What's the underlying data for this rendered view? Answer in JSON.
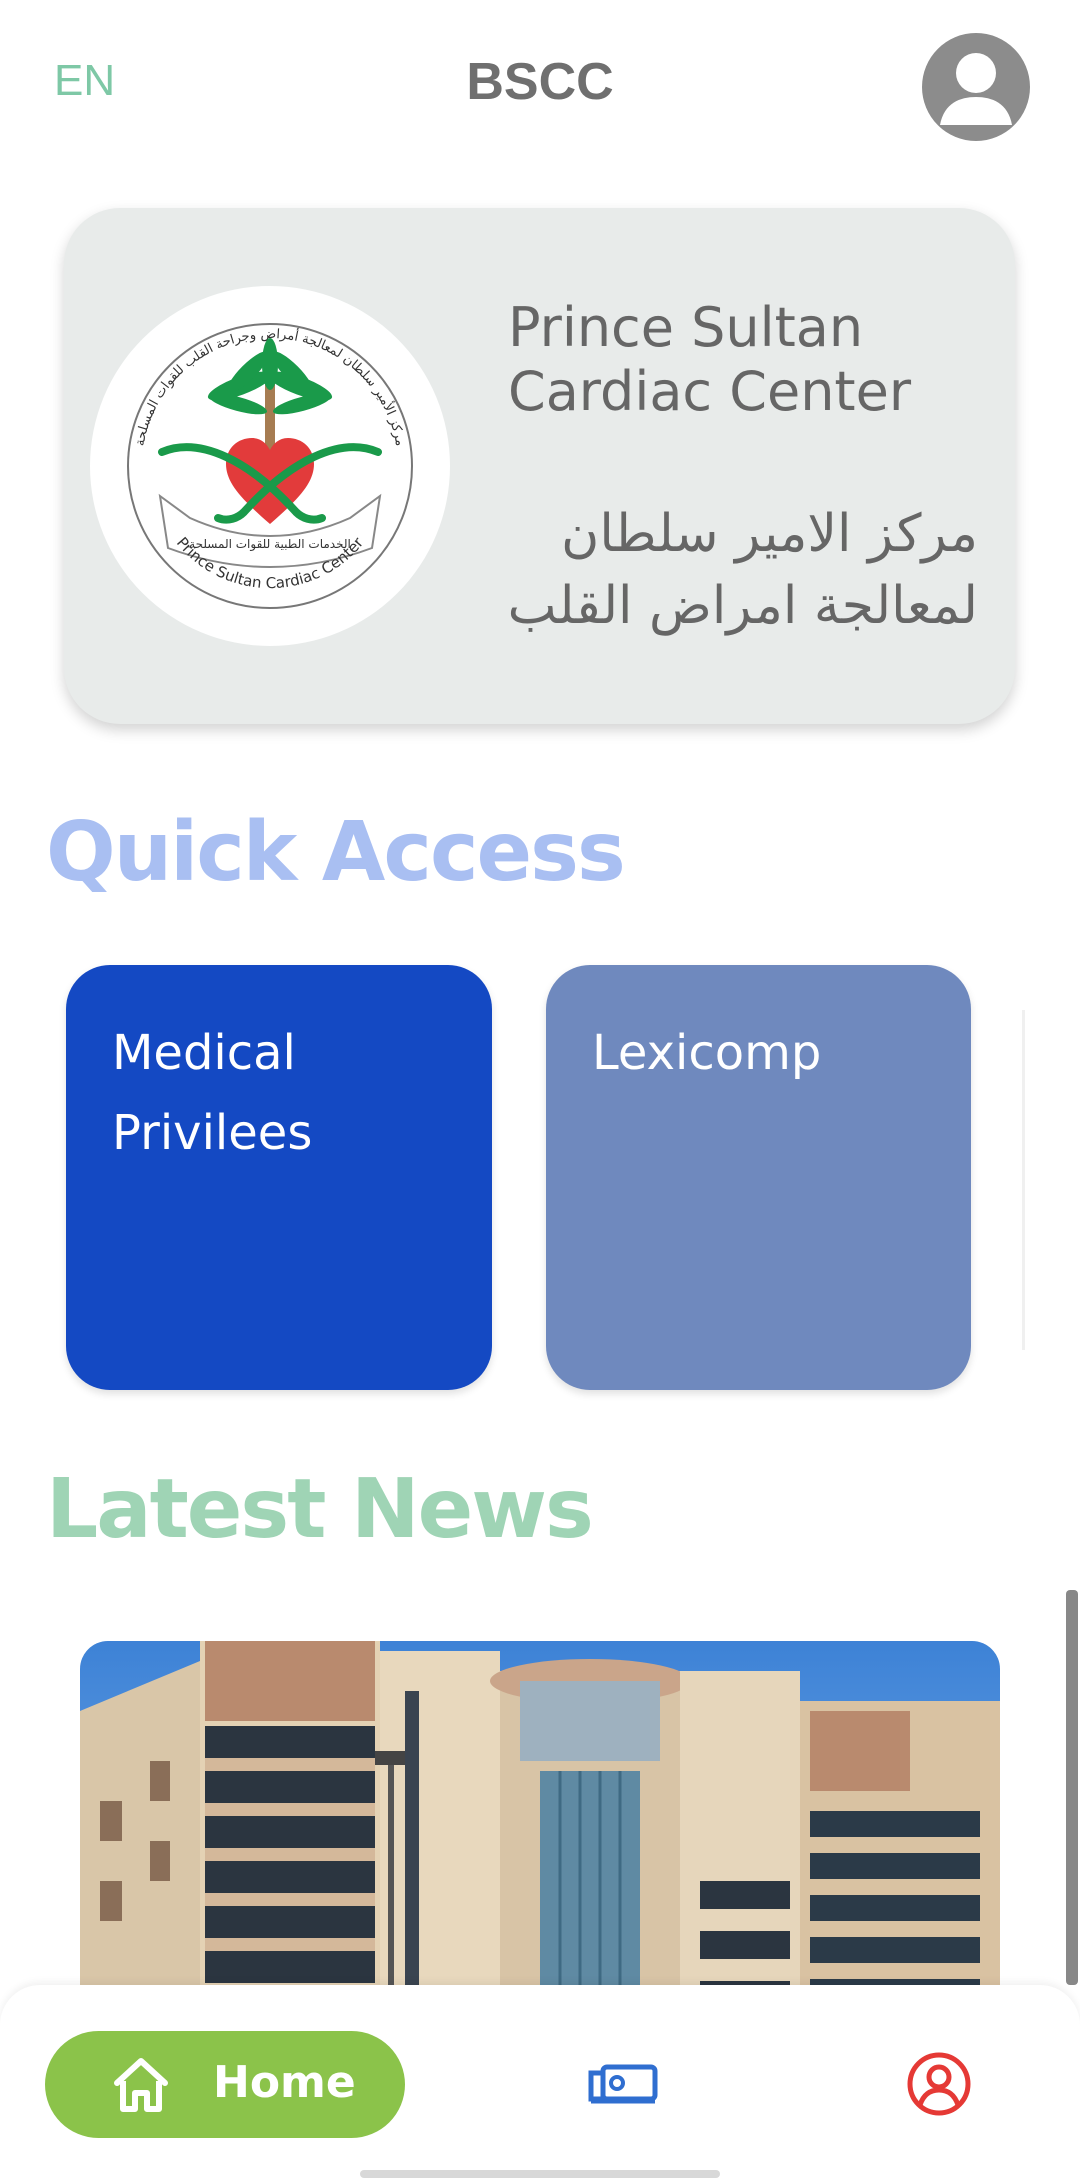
{
  "header": {
    "language": "EN",
    "app_title": "BSCC",
    "avatar_icon": "user-avatar-icon"
  },
  "hospital_card": {
    "logo_icon": "prince-sultan-cardiac-center-logo",
    "logo_ring_text_ar": "مركز الأمير سلطان لمعالجة أمراض وجراحة القلب للقوات المسلحة",
    "logo_ribbon_text_ar": "الخدمات الطبية للقوات المسلحة",
    "logo_ring_text_en": "Prince Sultan Cardiac Center",
    "title_en_line1": "Prince Sultan",
    "title_en_line2": "Cardiac Center",
    "title_ar_line1": "مركز الامير سلطان",
    "title_ar_line2": "لمعالجة امراض القلب"
  },
  "quick_access": {
    "title": "Quick Access",
    "tiles": [
      {
        "label_line1": "Medical",
        "label_line2": "Privilees",
        "color": "#1449c3"
      },
      {
        "label_line1": "Lexicomp",
        "label_line2": "",
        "color": "#6f89be"
      }
    ]
  },
  "latest_news": {
    "title": "Latest News",
    "image": "hospital-building-photo"
  },
  "bottom_nav": {
    "home_label": "Home",
    "home_icon": "home-icon",
    "news_icon": "news-icon",
    "profile_icon": "profile-icon",
    "active_color": "#8bc34a",
    "news_icon_color": "#2f6ed0",
    "profile_icon_color": "#e53935"
  }
}
